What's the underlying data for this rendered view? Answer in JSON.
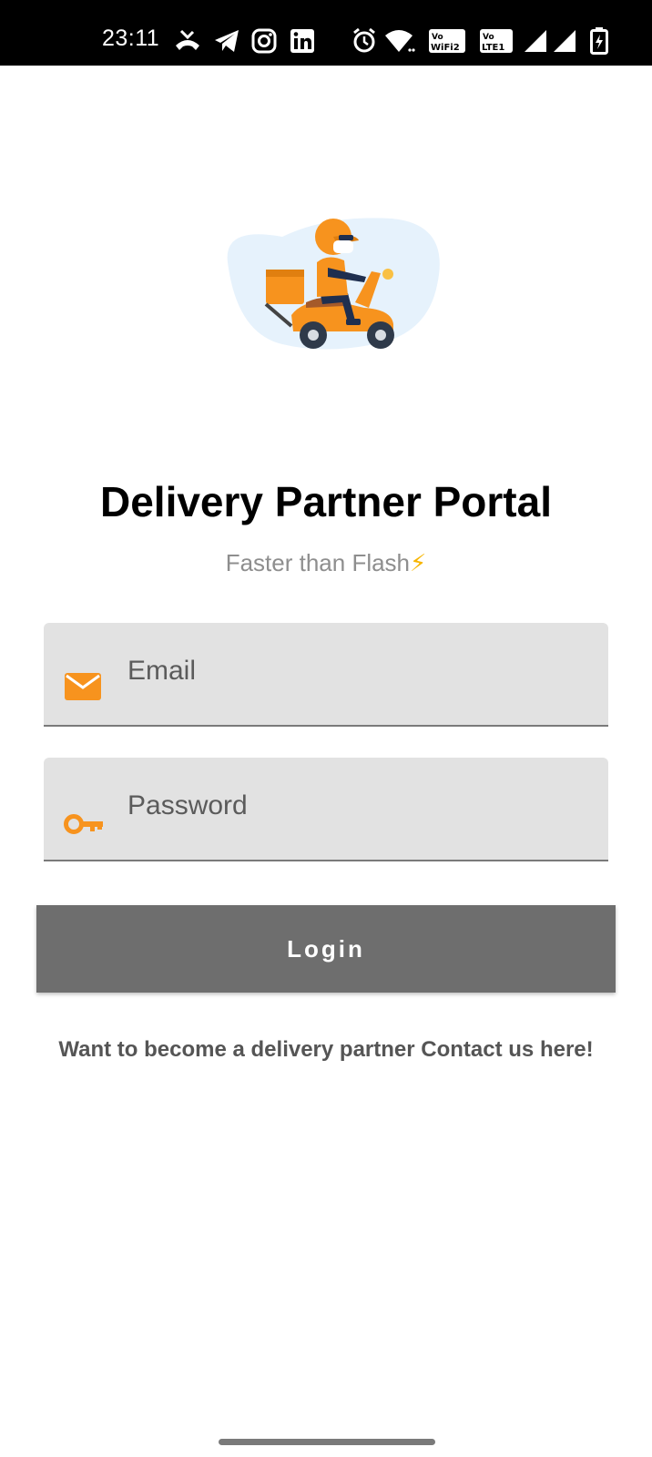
{
  "status_bar": {
    "time": "23:11",
    "icons": [
      "missed-call-icon",
      "telegram-icon",
      "instagram-icon",
      "linkedin-icon",
      "alarm-icon",
      "wifi-icon",
      "vowifi-icon",
      "volte-icon",
      "signal-icon",
      "signal-icon",
      "battery-icon"
    ],
    "vowifi_label": "Vo WiFi 2",
    "volte_label": "Vo LTE 1"
  },
  "hero": {
    "illustration": "delivery-scooter-illustration"
  },
  "header": {
    "title": "Delivery Partner Portal",
    "subtitle": "Faster than Flash",
    "subtitle_emoji": "⚡"
  },
  "form": {
    "email": {
      "placeholder": "Email",
      "value": "",
      "icon": "mail-icon"
    },
    "password": {
      "placeholder": "Password",
      "value": "",
      "icon": "key-icon"
    },
    "login_label": "Login"
  },
  "footer": {
    "contact_text": "Want to become a delivery partner Contact us here!"
  },
  "colors": {
    "accent": "#f7931e",
    "button": "#6e6e6e",
    "field_bg": "#e2e2e2"
  }
}
